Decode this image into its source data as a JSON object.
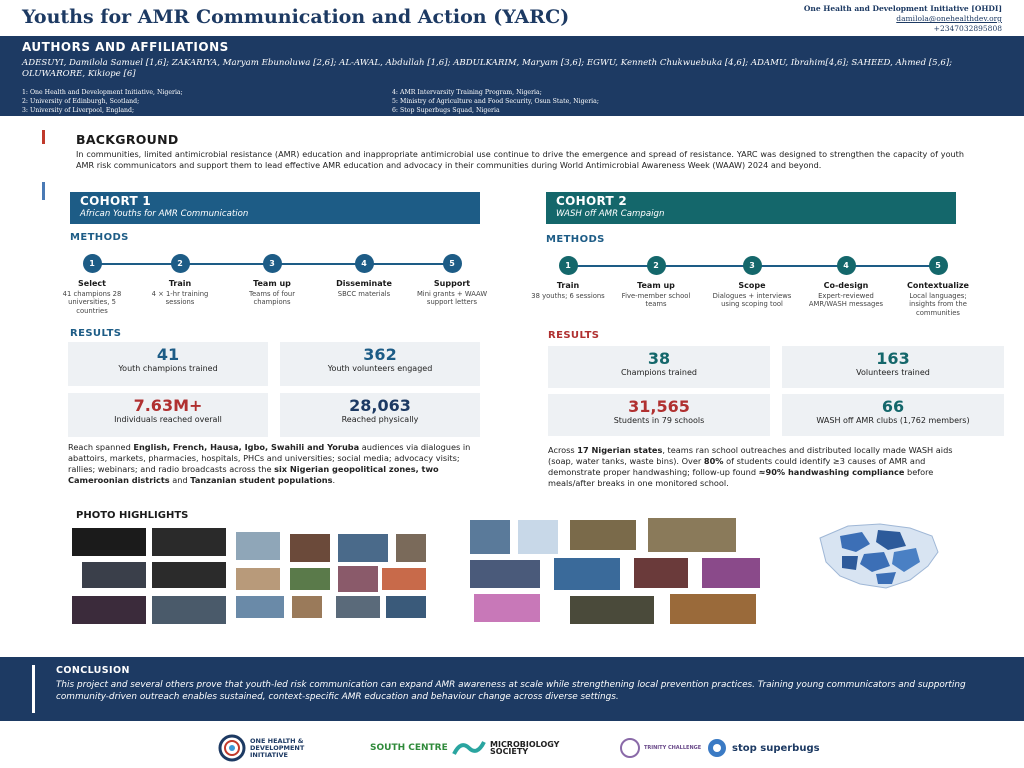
{
  "title": "Youths for AMR Communication and Action (YARC)",
  "org": {
    "name": "One Health and Development Initiative [OHDI]",
    "email": "damilola@onehealthdev.org",
    "phone": "+2347032895808"
  },
  "authors": {
    "heading": "AUTHORS AND AFFILIATIONS",
    "names": "ADESUYI, Damilola Samuel [1,6]; ZAKARIYA, Maryam Ebunoluwa [2,6]; AL-AWAL, Abdullah [1,6]; ABDULKARIM, Maryam [3,6]; EGWU, Kenneth Chukwuebuka [4,6]; ADAMU, Ibrahim[4,6]; SAHEED, Ahmed [5,6]; OLUWARORE, Kikiope [6]",
    "affiliations_left": [
      "1: One Health and Development Initiative, Nigeria;",
      "2: University of Edinburgh, Scotland;",
      "3: University of Liverpool, England;"
    ],
    "affiliations_right": [
      "4: AMR Intervarsity Training Program, Nigeria;",
      "5: Ministry of Agriculture and Food Security, Osun State, Nigeria;",
      "6: Stop Superbugs Squad, Nigeria"
    ]
  },
  "background": {
    "heading": "BACKGROUND",
    "text": "In communities, limited antimicrobial resistance (AMR) education and inappropriate antimicrobial use continue to drive the emergence and spread of resistance. YARC was designed to strengthen the capacity of youth AMR risk communicators and support them to lead effective AMR education and advocacy in their communities during World Antimicrobial Awareness Week (WAAW) 2024 and beyond."
  },
  "cohort1": {
    "title": "COHORT 1",
    "subtitle": "African Youths for AMR Communication",
    "methods_heading": "METHODS",
    "steps": [
      {
        "num": "1",
        "title": "Select",
        "desc": "41 champions 28 universities, 5 countries"
      },
      {
        "num": "2",
        "title": "Train",
        "desc": "4 × 1-hr training sessions"
      },
      {
        "num": "3",
        "title": "Team up",
        "desc": "Teams of four champions"
      },
      {
        "num": "4",
        "title": "Disseminate",
        "desc": "SBCC materials"
      },
      {
        "num": "5",
        "title": "Support",
        "desc": "Mini grants + WAAW support letters"
      }
    ],
    "results_heading": "RESULTS",
    "stats": [
      {
        "value": "41",
        "label": "Youth champions trained"
      },
      {
        "value": "362",
        "label": "Youth volunteers engaged"
      },
      {
        "value": "7.63M+",
        "label": "Individuals reached overall"
      },
      {
        "value": "28,063",
        "label": "Reached physically"
      }
    ],
    "text_parts": [
      "Reach spanned ",
      "English, French, Hausa, Igbo, Swahili and Yoruba",
      " audiences via dialogues in abattoirs, markets, pharmacies, hospitals, PHCs and universities; social media; advocacy visits; rallies; webinars; and radio broadcasts across the ",
      "six Nigerian geopolitical zones, two Cameroonian districts",
      " and ",
      "Tanzanian student populations",
      "."
    ]
  },
  "cohort2": {
    "title": "COHORT 2",
    "subtitle": "WASH off AMR Campaign",
    "methods_heading": "METHODS",
    "steps": [
      {
        "num": "1",
        "title": "Train",
        "desc": "38 youths; 6 sessions"
      },
      {
        "num": "2",
        "title": "Team up",
        "desc": "Five-member school teams"
      },
      {
        "num": "3",
        "title": "Scope",
        "desc": "Dialogues + interviews using scoping tool"
      },
      {
        "num": "4",
        "title": "Co-design",
        "desc": "Expert-reviewed AMR/WASH messages"
      },
      {
        "num": "5",
        "title": "Contextualize",
        "desc": "Local languages; insights from the communities"
      }
    ],
    "results_heading": "RESULTS",
    "stats": [
      {
        "value": "38",
        "label": "Champions trained"
      },
      {
        "value": "163",
        "label": "Volunteers trained"
      },
      {
        "value": "31,565",
        "label": "Students in 79 schools"
      },
      {
        "value": "66",
        "label": "WASH off AMR clubs (1,762 members)"
      }
    ],
    "text_parts": [
      "Across ",
      "17 Nigerian states",
      ", teams ran school outreaches and distributed locally made WASH aids (soap, water tanks, waste bins). Over ",
      "80%",
      " of students could identify ≥3 causes of AMR and demonstrate proper handwashing; follow-up found ",
      "≈90% handwashing compliance",
      " before meals/after breaks in one monitored school."
    ]
  },
  "photos_heading": "PHOTO HIGHLIGHTS",
  "conclusion": {
    "heading": "CONCLUSION",
    "text": "This project and several others  prove that youth-led risk communication can expand AMR awareness at scale while strengthening local prevention practices. Training young communicators and supporting community-driven outreach enables sustained, context-specific AMR education and behaviour change across diverse settings."
  },
  "logos": {
    "ohdi": "ONE HEALTH & DEVELOPMENT INITIATIVE",
    "south_centre": "SOUTH CENTRE",
    "microbiology": "MICROBIOLOGY SOCIETY",
    "trinity": "TRINITY CHALLENGE",
    "stop_superbugs": "stop superbugs"
  },
  "colors": {
    "navy": "#1d3a63",
    "cohort1": "#1d5c86",
    "cohort2": "#14676b",
    "accent_red": "#b03030"
  }
}
